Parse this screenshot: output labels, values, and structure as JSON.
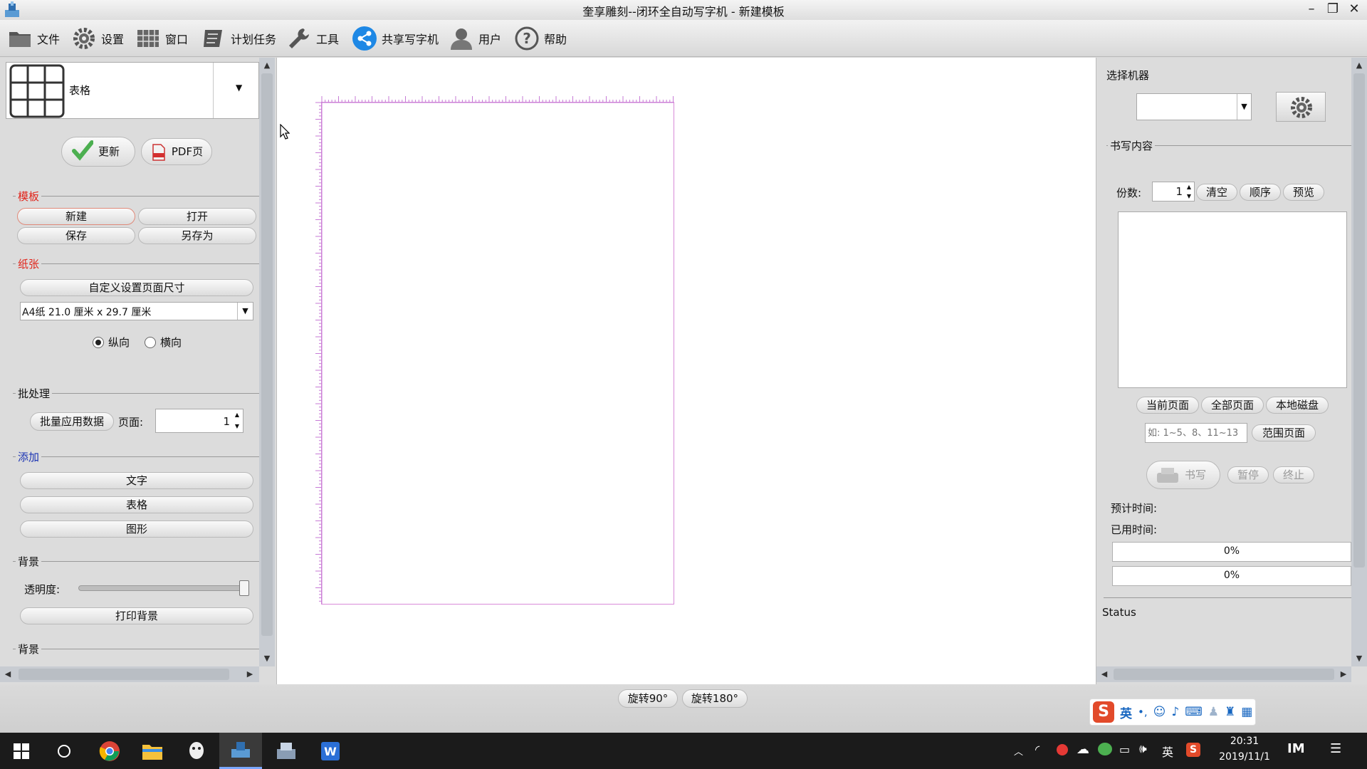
{
  "window": {
    "title": "奎享雕刻--闭环全自动写字机 - 新建模板"
  },
  "menu": [
    {
      "label": "文件",
      "icon": "folder-icon"
    },
    {
      "label": "设置",
      "icon": "gear-icon"
    },
    {
      "label": "窗口",
      "icon": "window-grid-icon"
    },
    {
      "label": "计划任务",
      "icon": "schedule-icon"
    },
    {
      "label": "工具",
      "icon": "wrench-icon"
    },
    {
      "label": "共享写字机",
      "icon": "share-icon"
    },
    {
      "label": "用户",
      "icon": "user-icon"
    },
    {
      "label": "帮助",
      "icon": "help-icon"
    }
  ],
  "left": {
    "template_type": "表格",
    "update_btn": "更新",
    "pdf_btn": "PDF页",
    "template_section": {
      "title": "模板",
      "new": "新建",
      "open": "打开",
      "save": "保存",
      "save_as": "另存为"
    },
    "paper_section": {
      "title": "纸张",
      "custom_size": "自定义设置页面尺寸",
      "paper_size": "A4纸 21.0 厘米 x 29.7 厘米",
      "portrait": "纵向",
      "landscape": "横向"
    },
    "batch_section": {
      "title": "批处理",
      "apply_btn": "批量应用数据",
      "page_label": "页面:",
      "page_value": "1"
    },
    "add_section": {
      "title": "添加",
      "text": "文字",
      "table": "表格",
      "shape": "图形"
    },
    "background_section": {
      "title": "背景",
      "opacity_label": "透明度:",
      "opacity_value": 1.0,
      "print_btn": "打印背景"
    },
    "background_section2": {
      "title": "背景"
    }
  },
  "right": {
    "select_machine": "选择机器",
    "write_content": "书写内容",
    "copies_label": "份数:",
    "copies_value": "1",
    "clear_btn": "清空",
    "order_btn": "顺序",
    "preview_btn": "预览",
    "current_page_btn": "当前页面",
    "all_pages_btn": "全部页面",
    "local_disk_btn": "本地磁盘",
    "range_placeholder": "如: 1~5、8、11~13",
    "range_btn": "范围页面",
    "write_btn": "书写",
    "pause_btn": "暂停",
    "stop_btn": "终止",
    "estimated_time_label": "预计时间:",
    "used_time_label": "已用时间:",
    "progress1": "0%",
    "progress2": "0%",
    "status_label": "Status"
  },
  "bottom": {
    "rotate90": "旋转90°",
    "rotate180": "旋转180°"
  },
  "ime": {
    "mode": "英"
  },
  "taskbar": {
    "apps": [
      "windows-start-icon",
      "search-circle-icon",
      "chrome-icon",
      "file-explorer-icon",
      "qq-icon",
      "writer-app-icon",
      "printer-app-icon",
      "word-app-icon"
    ],
    "tray_lang": "英",
    "time": "20:31",
    "date": "2019/11/1"
  },
  "colors": {
    "accent_red": "#e1251b",
    "accent_blue": "#1a33b3",
    "page_border": "#d88bd8",
    "share_blue": "#1e88e5"
  }
}
